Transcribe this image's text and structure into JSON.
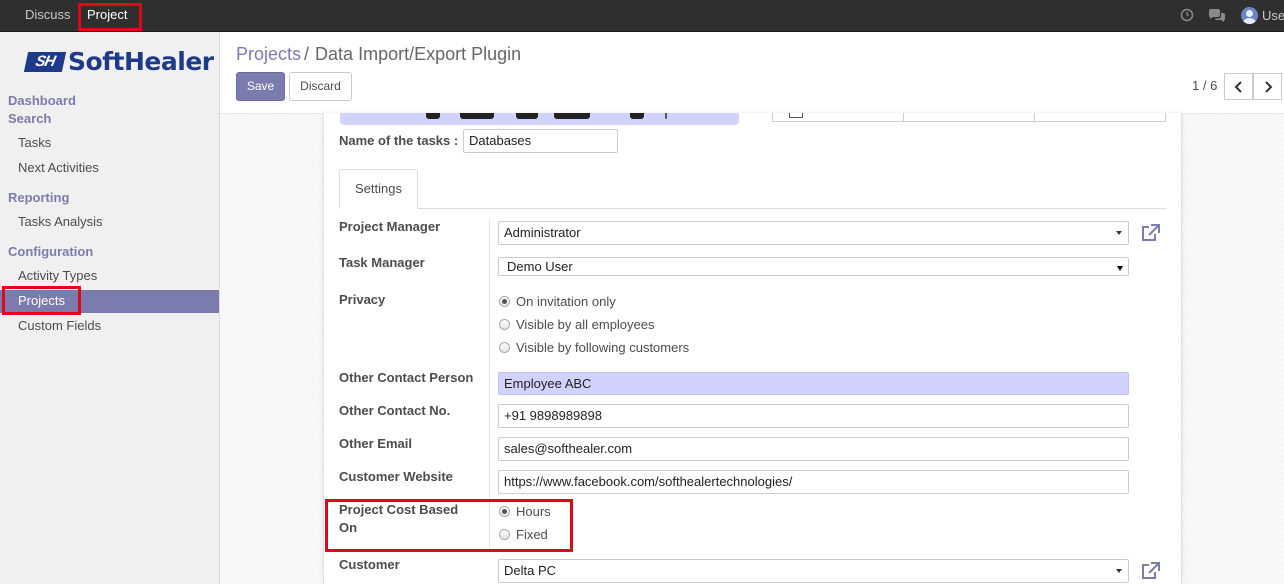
{
  "navbar": {
    "menus": [
      "Discuss",
      "Project"
    ],
    "user_label": "Use"
  },
  "sidebar": {
    "brand_mark": "SH",
    "brand_name": "SoftHealer",
    "sections": [
      {
        "heading": "Dashboard"
      },
      {
        "heading": "Search",
        "items": [
          "Tasks",
          "Next Activities"
        ]
      },
      {
        "heading": "Reporting",
        "items": [
          "Tasks Analysis"
        ]
      },
      {
        "heading": "Configuration",
        "items": [
          "Activity Types",
          "Projects",
          "Custom Fields"
        ]
      }
    ],
    "active_item": "Projects"
  },
  "breadcrumb": {
    "parent": "Projects",
    "separator": "/",
    "current": "Data Import/Export Plugin"
  },
  "buttons": {
    "save": "Save",
    "discard": "Discard"
  },
  "pager": {
    "text": "1 / 6"
  },
  "form": {
    "task_name_label": "Name of the tasks :",
    "task_name_value": "Databases",
    "tab": "Settings",
    "fields": {
      "project_manager": {
        "label": "Project Manager",
        "value": "Administrator"
      },
      "task_manager": {
        "label": "Task Manager",
        "value": "Demo User"
      },
      "privacy": {
        "label": "Privacy",
        "options": [
          "On invitation only",
          "Visible by all employees",
          "Visible by following customers"
        ],
        "selected": "On invitation only"
      },
      "other_contact_person": {
        "label": "Other Contact Person",
        "value": "Employee ABC"
      },
      "other_contact_no": {
        "label": "Other Contact No.",
        "value": "+91 9898989898"
      },
      "other_email": {
        "label": "Other Email",
        "value": "sales@softhealer.com"
      },
      "customer_website": {
        "label": "Customer Website",
        "value": "https://www.facebook.com/softhealertechnologies/"
      },
      "project_cost_based_on": {
        "label_line1": "Project Cost Based",
        "label_line2": "On",
        "options": [
          "Hours",
          "Fixed"
        ],
        "selected": "Hours"
      },
      "customer": {
        "label": "Customer",
        "value": "Delta PC"
      }
    }
  },
  "colors": {
    "accent": "#7c7bad",
    "required_field_bg": "#d2d2ff",
    "highlight_box": "#e2061b",
    "navbar_bg": "#2f2f2f"
  }
}
